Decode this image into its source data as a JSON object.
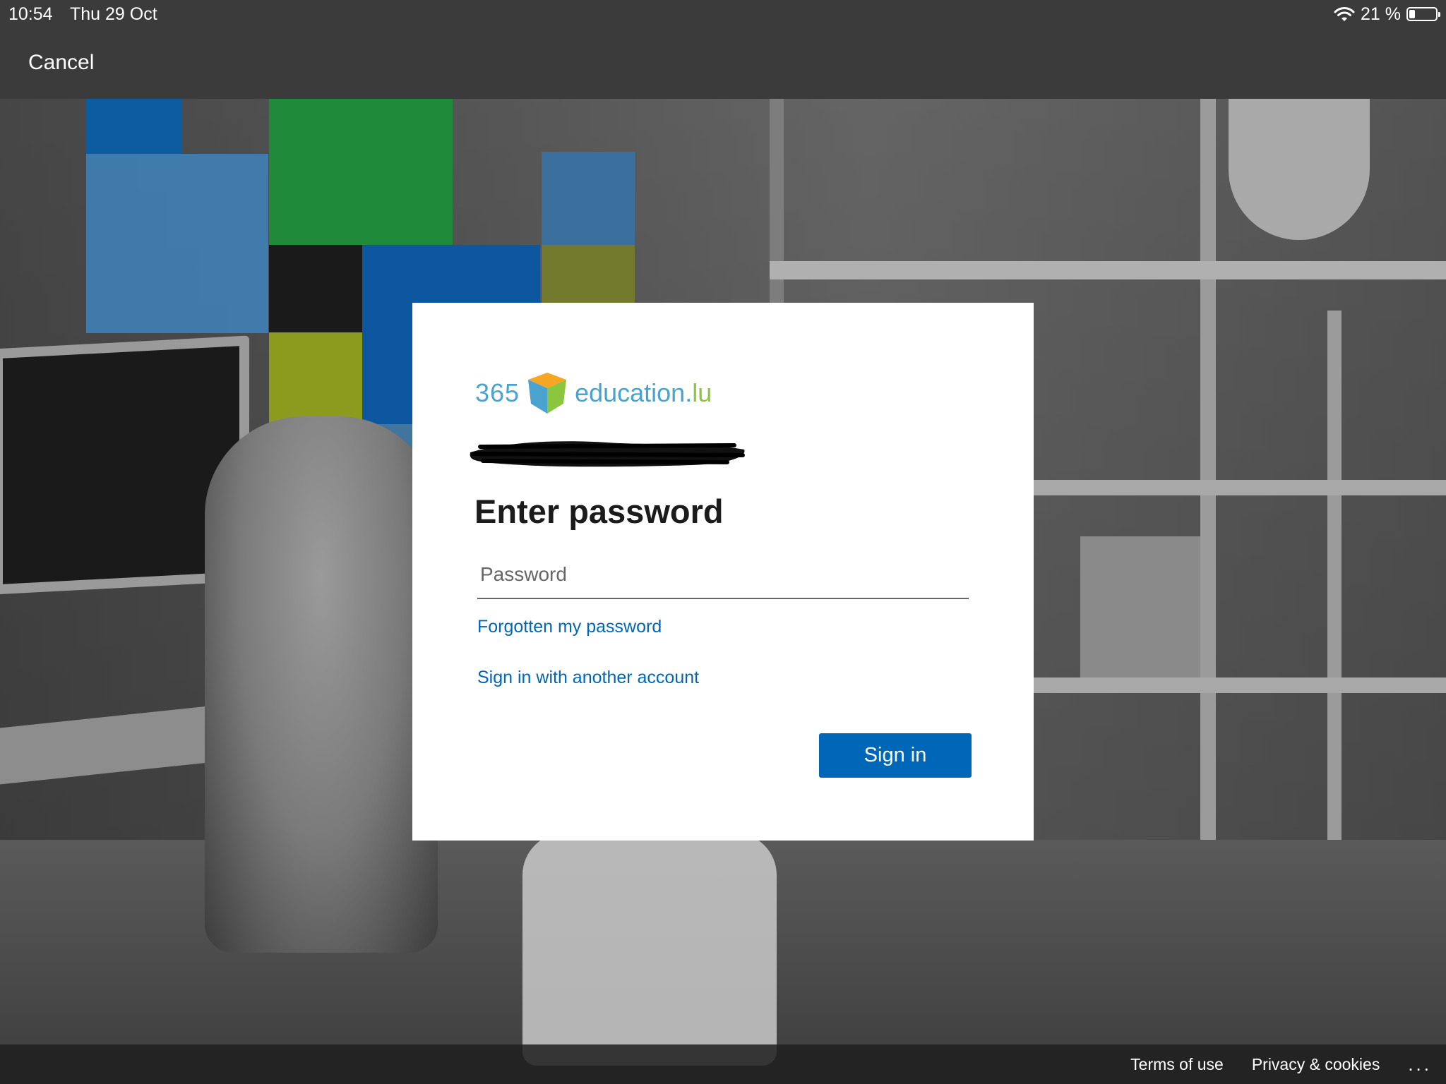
{
  "status_bar": {
    "time": "10:54",
    "date": "Thu 29 Oct",
    "battery_percent": "21 %",
    "battery_level": 0.21,
    "icons": [
      "wifi-icon",
      "battery-icon"
    ]
  },
  "nav": {
    "cancel_label": "Cancel"
  },
  "logo": {
    "prefix": "365",
    "domain_main": "education.",
    "domain_tld": "lu",
    "colors": {
      "blue": "#4aa3cf",
      "green": "#8cc63f",
      "orange": "#f5a623"
    }
  },
  "login": {
    "title": "Enter password",
    "password_placeholder": "Password",
    "password_value": "",
    "forgot_link": "Forgotten my password",
    "other_account_link": "Sign in with another account",
    "signin_button": "Sign in"
  },
  "footer": {
    "terms": "Terms of use",
    "privacy": "Privacy & cookies",
    "more": "..."
  },
  "colors": {
    "accent": "#0067b8",
    "topbar": "#3b3b3b",
    "card": "#ffffff"
  }
}
